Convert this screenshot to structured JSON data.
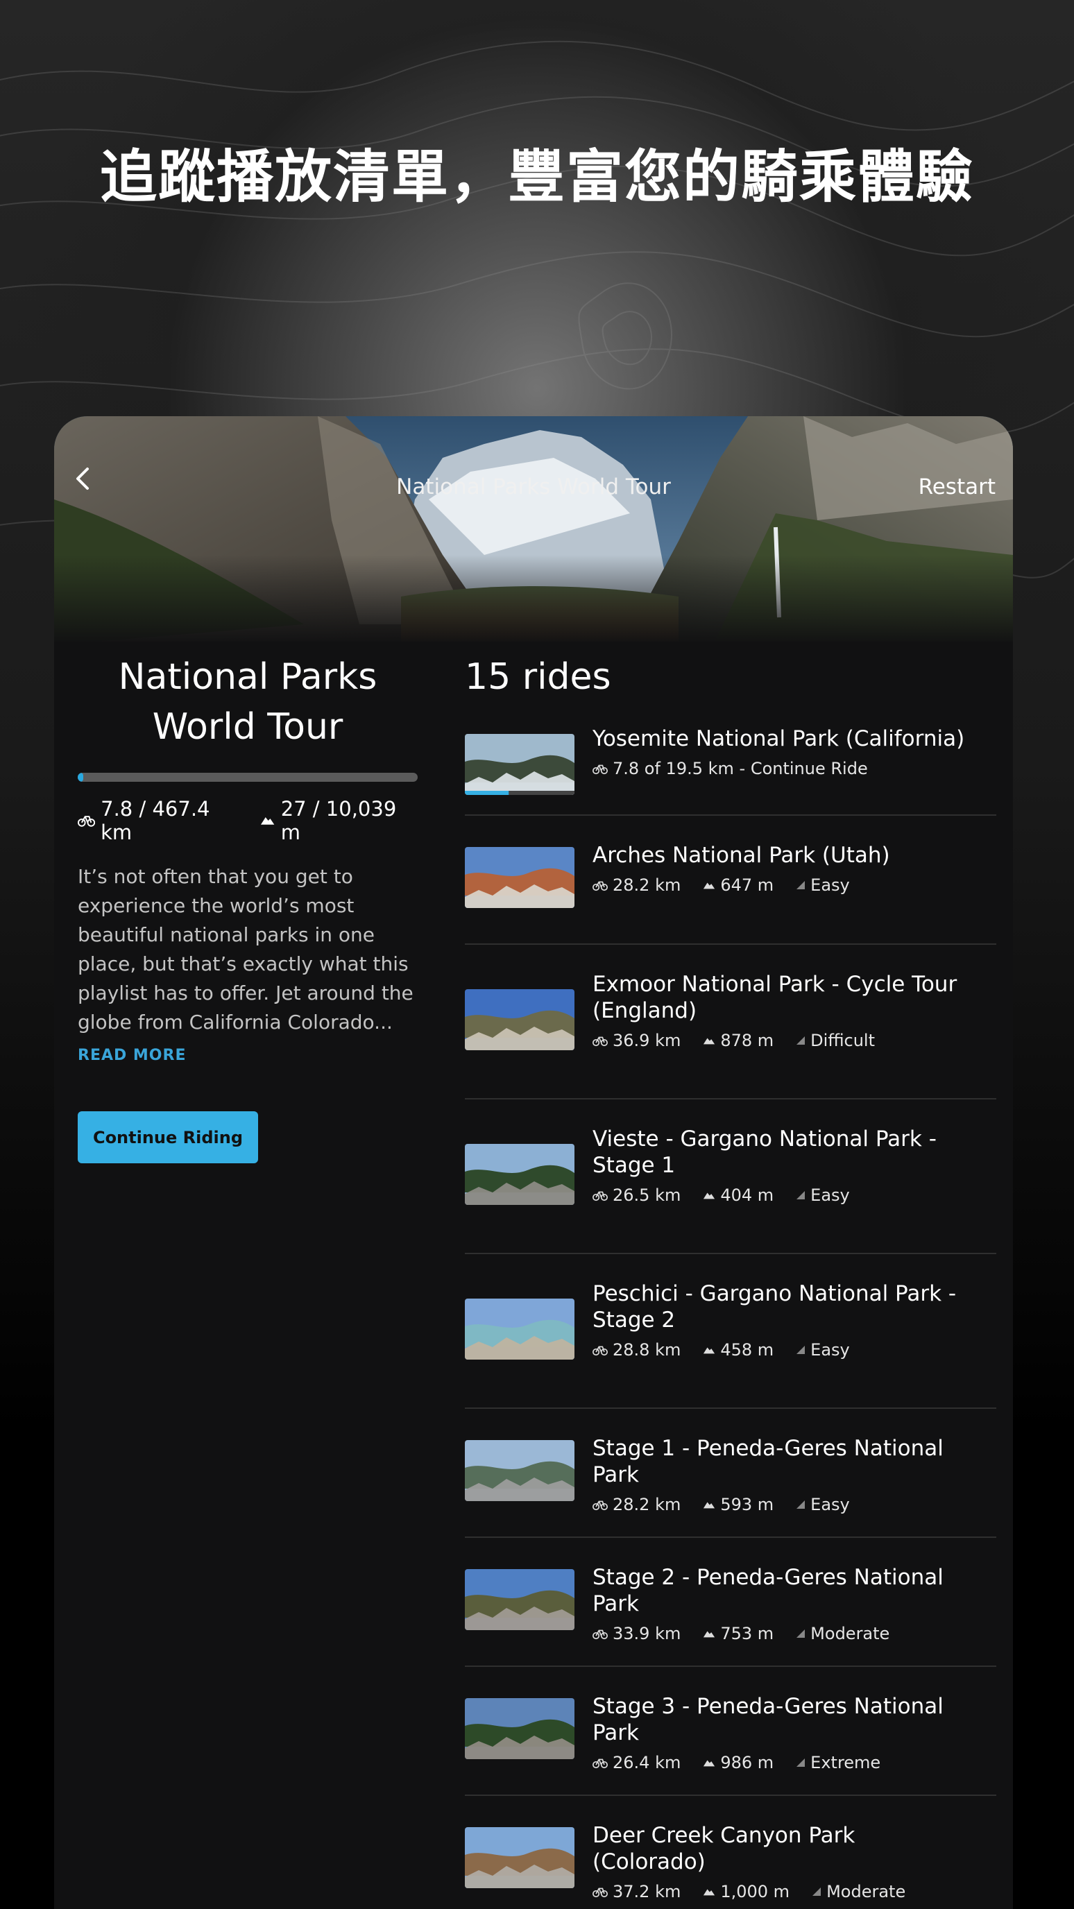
{
  "headline": "追蹤播放清單，豐富您的騎乘體驗",
  "header": {
    "title": "National Parks World Tour",
    "restart_label": "Restart"
  },
  "playlist": {
    "title_line1": "National Parks",
    "title_line2": "World Tour",
    "progress_fraction": 0.0167,
    "distance": "7.8 / 467.4 km",
    "elevation": "27 / 10,039 m",
    "description": "It’s not often that you get to experience the world’s most beautiful national parks in one place, but that’s exactly what this playlist has to offer. Jet around the globe from California Colorado...",
    "read_more": "READ MORE",
    "continue_label": "Continue Riding"
  },
  "rides_count": "15 rides",
  "rides": [
    {
      "name": "Yosemite National Park (California)",
      "distance": "7.8 of 19.5 km - Continue Ride",
      "elevation": "",
      "difficulty": "",
      "progress_fraction": 0.4,
      "colors": [
        "#9fb9cc",
        "#3c4a3a",
        "#d8dee2"
      ]
    },
    {
      "name": "Arches National Park (Utah)",
      "distance": "28.2 km",
      "elevation": "647 m",
      "difficulty": "Easy",
      "progress_fraction": 0,
      "colors": [
        "#5a86c6",
        "#b2633e",
        "#d9d2c7"
      ]
    },
    {
      "name": "Exmoor National Park - Cycle Tour (England)",
      "distance": "36.9 km",
      "elevation": "878 m",
      "difficulty": "Difficult",
      "progress_fraction": 0,
      "colors": [
        "#3f6fc0",
        "#6b6a4c",
        "#c9c2b2"
      ]
    },
    {
      "name": "Vieste - Gargano National Park - Stage 1",
      "distance": "26.5 km",
      "elevation": "404 m",
      "difficulty": "Easy",
      "progress_fraction": 0,
      "colors": [
        "#8cb0d4",
        "#2f4a2c",
        "#8c8a84"
      ]
    },
    {
      "name": "Peschici - Gargano National Park - Stage 2",
      "distance": "28.8 km",
      "elevation": "458 m",
      "difficulty": "Easy",
      "progress_fraction": 0,
      "colors": [
        "#7fa6d8",
        "#7fb8c4",
        "#bfb3a0"
      ]
    },
    {
      "name": "Stage 1 - Peneda-Geres National Park",
      "distance": "28.2 km",
      "elevation": "593 m",
      "difficulty": "Easy",
      "progress_fraction": 0,
      "colors": [
        "#9bb8d6",
        "#566e5a",
        "#9c9c9c"
      ]
    },
    {
      "name": "Stage 2 - Peneda-Geres National Park",
      "distance": "33.9 km",
      "elevation": "753 m",
      "difficulty": "Moderate",
      "progress_fraction": 0,
      "colors": [
        "#4f7fc3",
        "#5a5e3c",
        "#a09a92"
      ]
    },
    {
      "name": "Stage 3 - Peneda-Geres National Park",
      "distance": "26.4 km",
      "elevation": "986 m",
      "difficulty": "Extreme",
      "progress_fraction": 0,
      "colors": [
        "#5d84b8",
        "#2d4a28",
        "#8f8a82"
      ]
    },
    {
      "name": "Deer Creek Canyon Park (Colorado)",
      "distance": "37.2 km",
      "elevation": "1,000 m",
      "difficulty": "Moderate",
      "progress_fraction": 0,
      "colors": [
        "#7ea7d6",
        "#8b6a4a",
        "#b0aba2"
      ]
    }
  ],
  "colors": {
    "accent": "#36b0e4",
    "link": "#3aa5d9",
    "panel": "#111112"
  }
}
